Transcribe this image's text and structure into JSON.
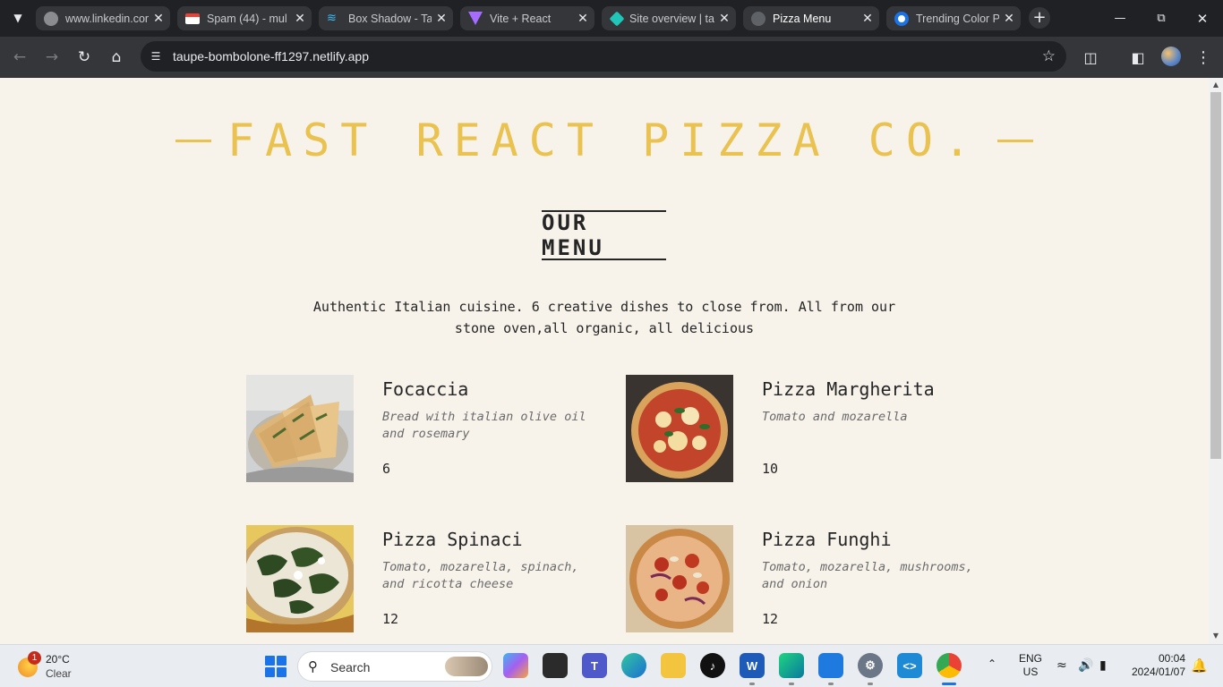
{
  "browser": {
    "tabs": [
      {
        "title": "www.linkedin.com",
        "favicon": "globe-icon",
        "color": "#8a8c90",
        "active": false
      },
      {
        "title": "Spam (44) - mul",
        "favicon": "gmail-icon",
        "color": "#ea4335",
        "active": false
      },
      {
        "title": "Box Shadow - Ta",
        "favicon": "tailwind-icon",
        "color": "#38bdf8",
        "active": false
      },
      {
        "title": "Vite + React",
        "favicon": "vite-icon",
        "color": "#a56cff",
        "active": false
      },
      {
        "title": "Site overview | ta",
        "favicon": "netlify-icon",
        "color": "#20c6b7",
        "active": false
      },
      {
        "title": "Pizza Menu",
        "favicon": "globe-icon",
        "color": "#8a8c90",
        "active": true
      },
      {
        "title": "Trending Color P",
        "favicon": "coolors-icon",
        "color": "#1a73e8",
        "active": false
      }
    ],
    "url": "taupe-bombolone-ff1297.netlify.app"
  },
  "page": {
    "brand": "FAST REACT PIZZA CO.",
    "menu_heading": "OUR MENU",
    "intro": "Authentic Italian cuisine. 6 creative dishes to close from. All from our stone oven,all organic, all delicious",
    "accent_color": "#e9c24f",
    "pizzas": [
      {
        "name": "Focaccia",
        "ingredients": "Bread with italian olive oil and rosemary",
        "price": "6"
      },
      {
        "name": "Pizza Margherita",
        "ingredients": "Tomato and mozarella",
        "price": "10"
      },
      {
        "name": "Pizza Spinaci",
        "ingredients": "Tomato, mozarella, spinach, and ricotta cheese",
        "price": "12"
      },
      {
        "name": "Pizza Funghi",
        "ingredients": "Tomato, mozarella, mushrooms, and onion",
        "price": "12"
      }
    ]
  },
  "taskbar": {
    "weather_badge": "1",
    "temperature": "20°C",
    "condition": "Clear",
    "search_label": "Search",
    "lang_1": "ENG",
    "lang_2": "US",
    "time": "00:04",
    "date": "2024/01/07",
    "apps": [
      "copilot-icon",
      "file-manager-icon",
      "teams-icon",
      "edge-icon",
      "file-explorer-icon",
      "tiktok-icon",
      "word-icon",
      "pycharm-icon",
      "paint-icon",
      "settings-icon",
      "vscode-icon",
      "chrome-icon"
    ]
  }
}
